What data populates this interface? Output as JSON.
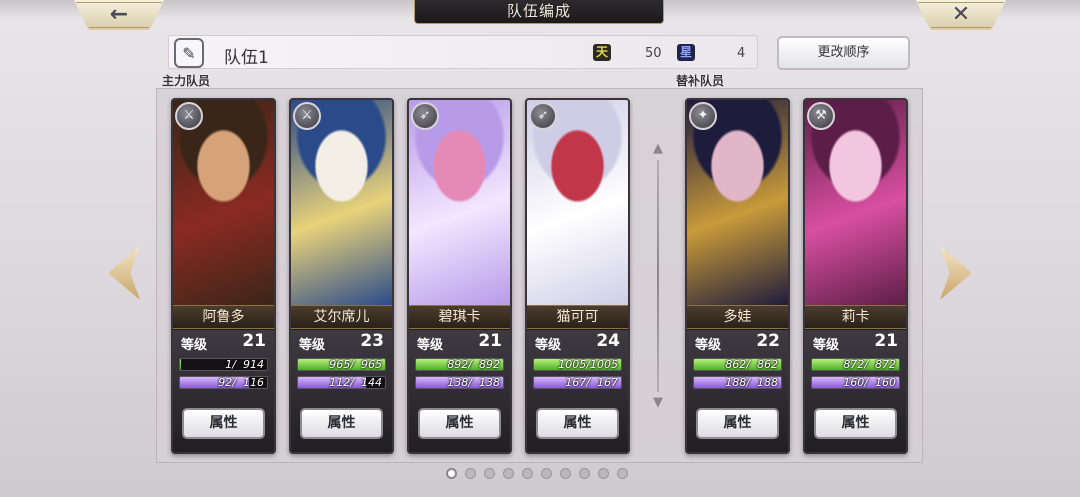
{
  "header": {
    "title": "队伍编成",
    "back_icon": "←",
    "close_icon": "✕"
  },
  "team": {
    "name": "队伍1",
    "edit_icon": "✎",
    "cost_a_icon": "天",
    "cost_a": "50",
    "cost_b_icon": "星",
    "cost_b": "4",
    "reorder_label": "更改顺序"
  },
  "sections": {
    "main": "主力队员",
    "sub": "替补队员"
  },
  "level_label": "等级",
  "attr_label": "属性",
  "members": [
    {
      "name": "阿鲁多",
      "level": "21",
      "hp": "   1/  914",
      "hp_frac": 0.01,
      "mp": "  92/  116",
      "mp_frac": 0.79,
      "class_icon": "⚔",
      "colors": [
        "#3a2618",
        "#8b2a22",
        "#d6a27a"
      ]
    },
    {
      "name": "艾尔席儿",
      "level": "23",
      "hp": " 965/  965",
      "hp_frac": 1.0,
      "mp": " 112/  144",
      "mp_frac": 0.78,
      "class_icon": "⚔",
      "colors": [
        "#2a4a8a",
        "#e8d27a",
        "#f4efe6"
      ]
    },
    {
      "name": "碧琪卡",
      "level": "21",
      "hp": " 892/  892",
      "hp_frac": 1.0,
      "mp": " 138/  138",
      "mp_frac": 1.0,
      "class_icon": "➶",
      "colors": [
        "#b79be8",
        "#f3e6ff",
        "#e58ab7"
      ]
    },
    {
      "name": "猫可可",
      "level": "24",
      "hp": "1005/1005",
      "hp_frac": 1.0,
      "mp": " 167/  167",
      "mp_frac": 1.0,
      "class_icon": "➶",
      "colors": [
        "#cfcde6",
        "#ffffff",
        "#c2364a"
      ]
    },
    {
      "name": "多娃",
      "level": "22",
      "hp": " 862/  862",
      "hp_frac": 1.0,
      "mp": " 188/  188",
      "mp_frac": 1.0,
      "class_icon": "✦",
      "colors": [
        "#1e1c3c",
        "#c89a3a",
        "#e0b6c8"
      ]
    },
    {
      "name": "莉卡",
      "level": "21",
      "hp": " 872/  872",
      "hp_frac": 1.0,
      "mp": " 160/  160",
      "mp_frac": 1.0,
      "class_icon": "⚒",
      "colors": [
        "#5c1e48",
        "#d84fa0",
        "#f2c6e0"
      ]
    }
  ],
  "pager": {
    "total": 10,
    "active": 0
  }
}
